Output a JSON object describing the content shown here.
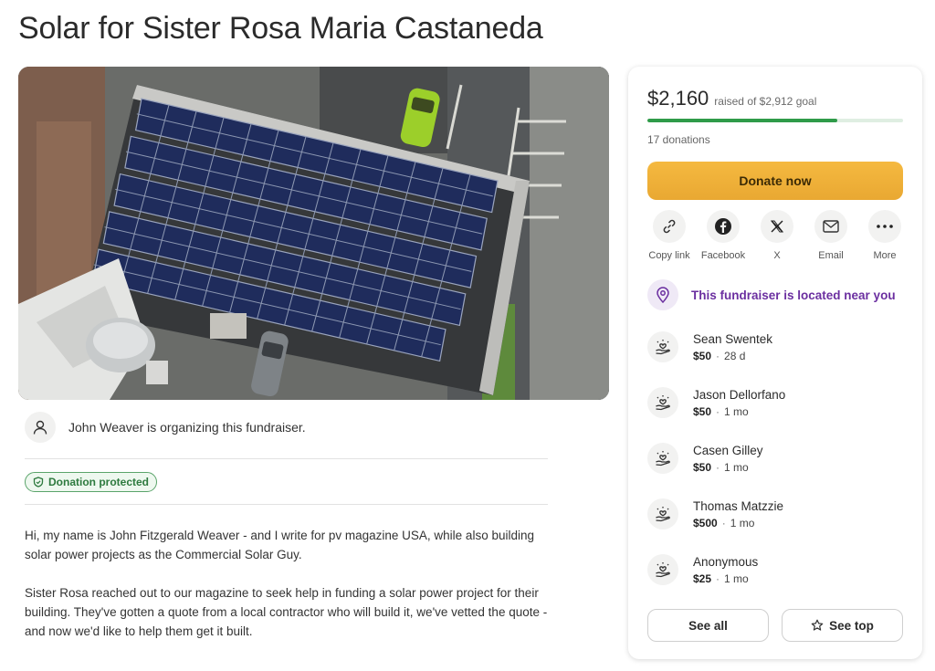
{
  "title": "Solar for Sister Rosa Maria Castaneda",
  "organizer": {
    "text": "John Weaver is organizing this fundraiser."
  },
  "protection_badge": "Donation protected",
  "story": {
    "p1": "Hi, my name is John Fitzgerald Weaver - and I write for pv magazine USA, while also building solar power projects as the Commercial Solar Guy.",
    "p2": "Sister Rosa reached out to our magazine to seek help in funding a solar power project for their building. They've gotten a quote from a local contractor who will build it, we've vetted the quote - and now we'd like to help them get it built."
  },
  "panel": {
    "raised_amount": "$2,160",
    "raised_goal": "raised of $2,912 goal",
    "progress_fraction": 0.742,
    "donations_count": "17 donations",
    "donate_label": "Donate now",
    "share": [
      {
        "label": "Copy link",
        "icon": "link-icon"
      },
      {
        "label": "Facebook",
        "icon": "facebook-icon"
      },
      {
        "label": "X",
        "icon": "x-icon"
      },
      {
        "label": "Email",
        "icon": "email-icon"
      },
      {
        "label": "More",
        "icon": "more-icon"
      }
    ],
    "nearby_text": "This fundraiser is located near you",
    "donors": [
      {
        "name": "Sean Swentek",
        "amount": "$50",
        "time": "28 d"
      },
      {
        "name": "Jason Dellorfano",
        "amount": "$50",
        "time": "1 mo"
      },
      {
        "name": "Casen Gilley",
        "amount": "$50",
        "time": "1 mo"
      },
      {
        "name": "Thomas Matzzie",
        "amount": "$500",
        "time": "1 mo"
      },
      {
        "name": "Anonymous",
        "amount": "$25",
        "time": "1 mo"
      }
    ],
    "see_all_label": "See all",
    "see_top_label": "See top"
  },
  "colors": {
    "accent_purple": "#6b2fa0",
    "progress_green": "#2f9b49",
    "donate_orange": "#f5b940"
  }
}
